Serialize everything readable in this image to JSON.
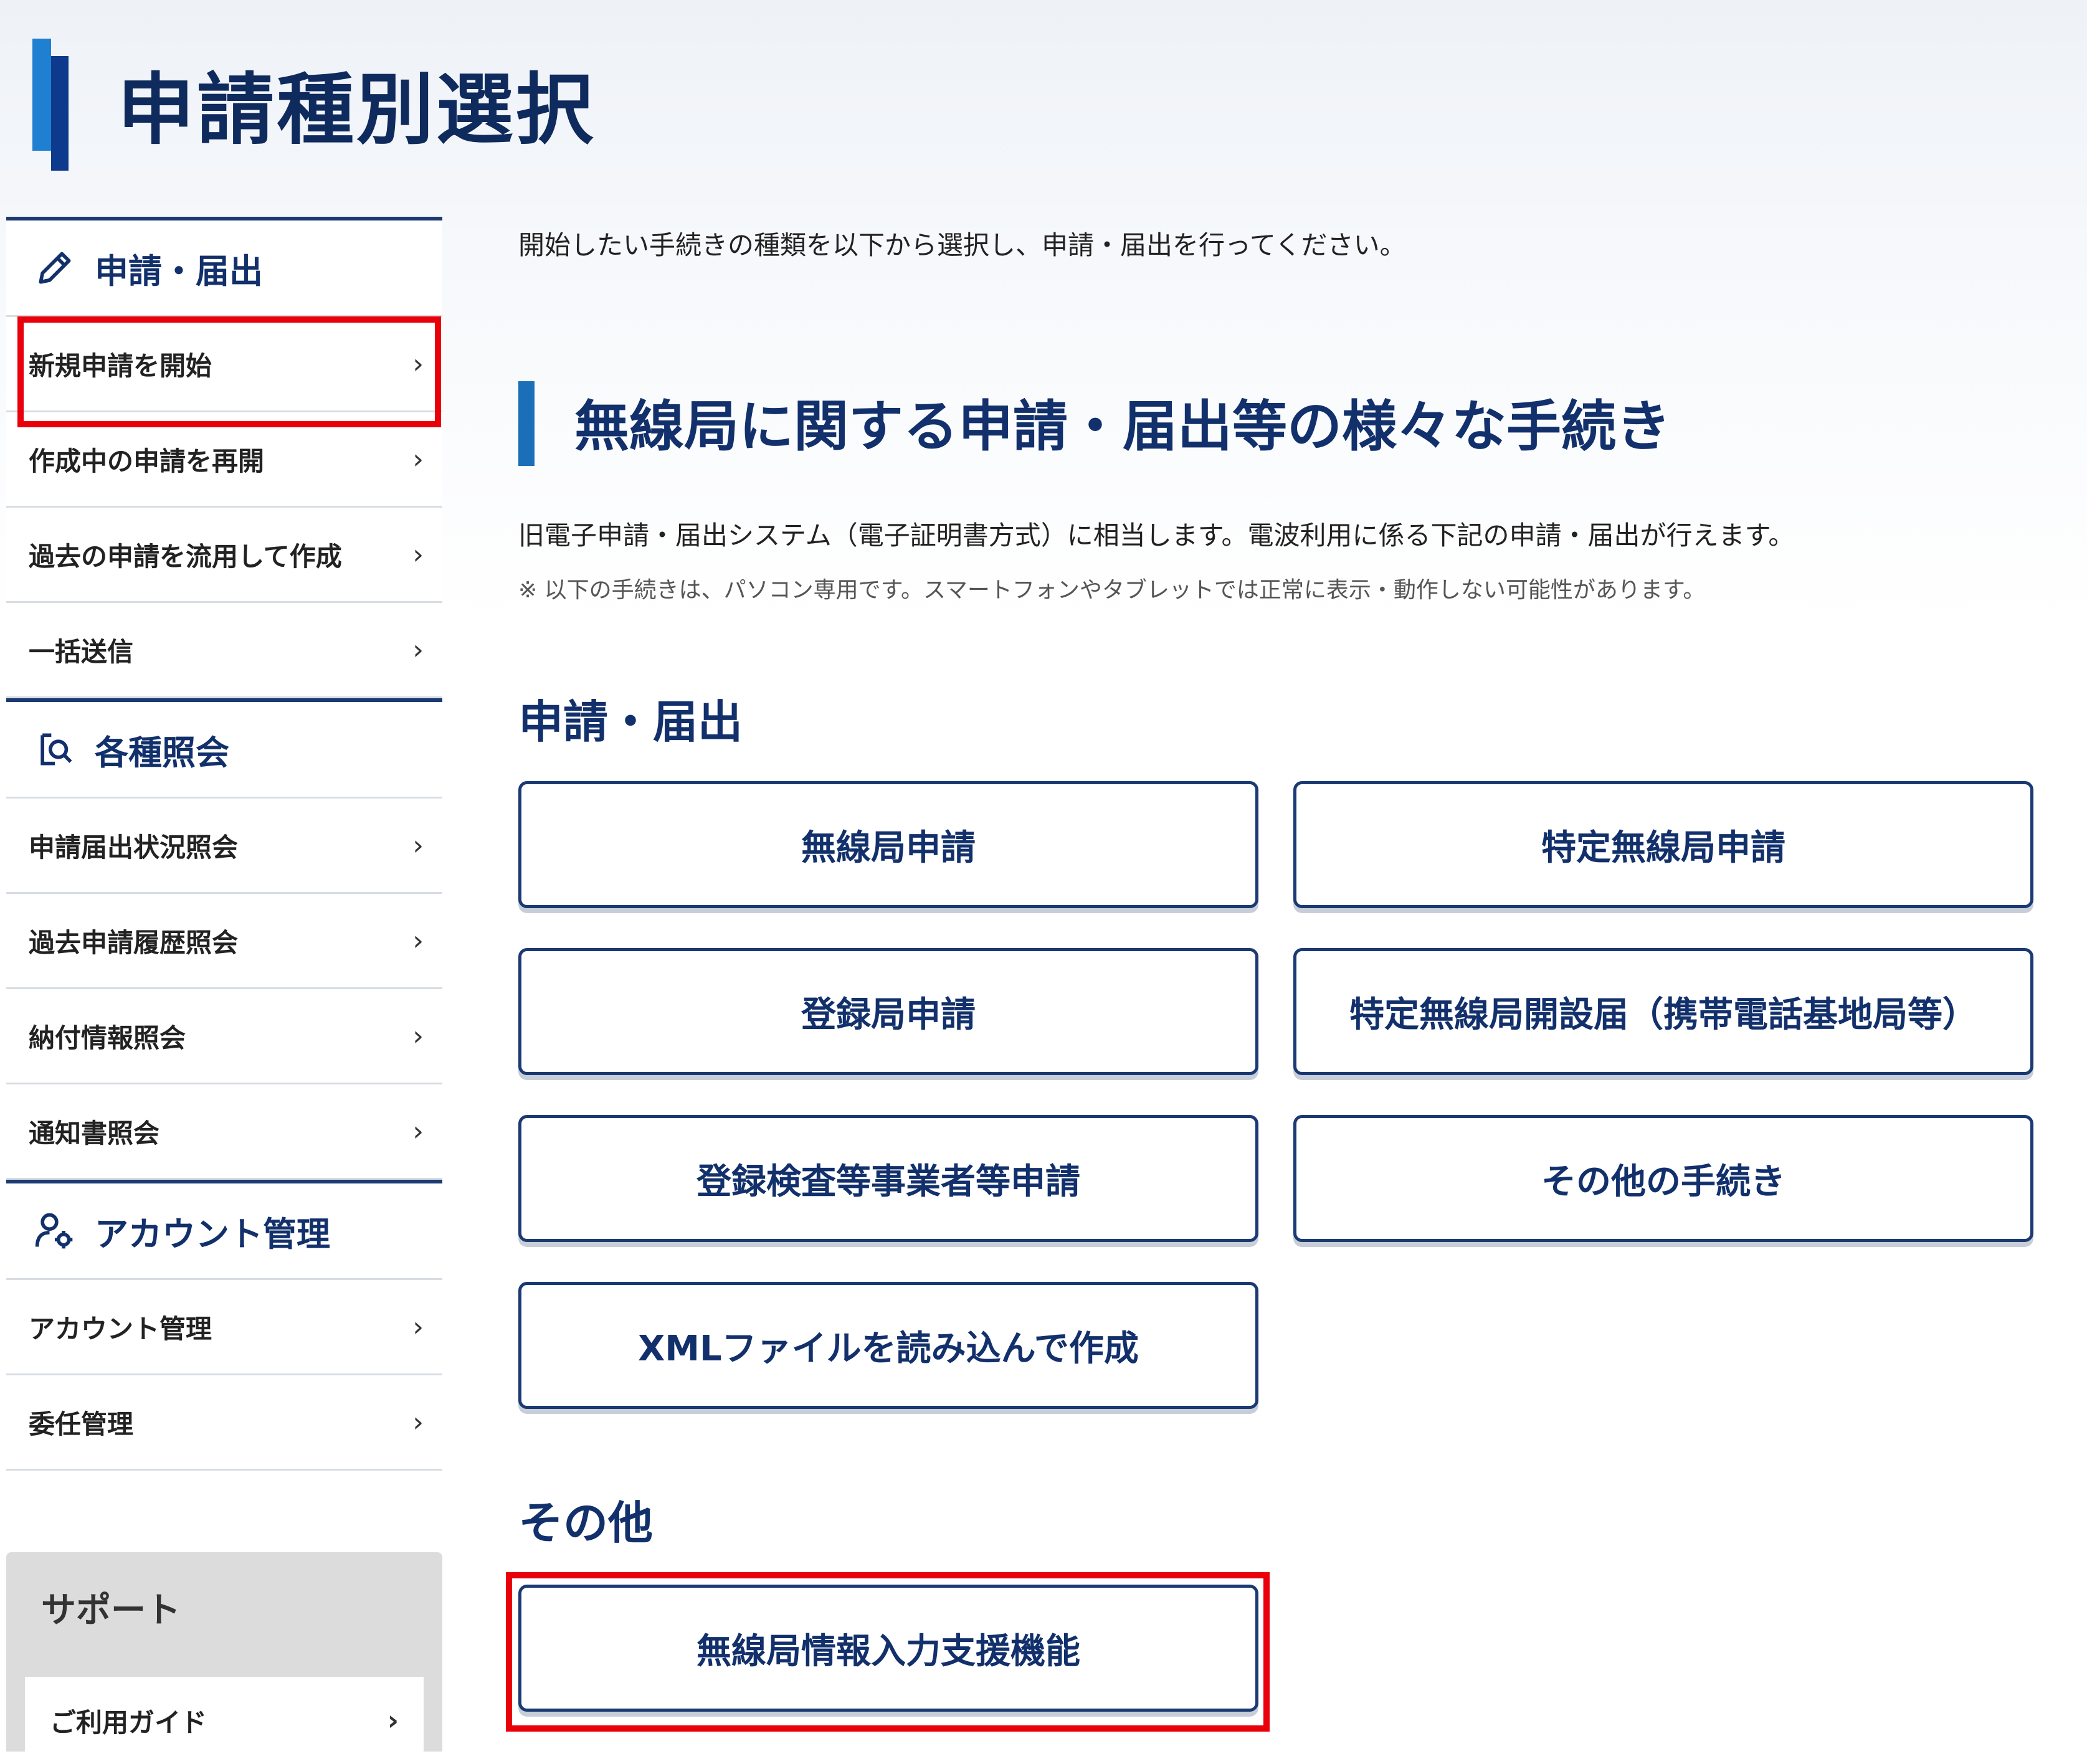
{
  "page": {
    "title": "申請種別選択"
  },
  "sidebar": {
    "sections": [
      {
        "heading": "申請・届出",
        "icon": "pencil-icon",
        "items": [
          {
            "label": "新規申請を開始",
            "highlighted": true
          },
          {
            "label": "作成中の申請を再開"
          },
          {
            "label": "過去の申請を流用して作成"
          },
          {
            "label": "一括送信"
          }
        ]
      },
      {
        "heading": "各種照会",
        "icon": "document-search-icon",
        "items": [
          {
            "label": "申請届出状況照会"
          },
          {
            "label": "過去申請履歴照会"
          },
          {
            "label": "納付情報照会"
          },
          {
            "label": "通知書照会"
          }
        ]
      },
      {
        "heading": "アカウント管理",
        "icon": "user-gear-icon",
        "items": [
          {
            "label": "アカウント管理"
          },
          {
            "label": "委任管理"
          }
        ]
      }
    ],
    "support": {
      "heading": "サポート",
      "items": [
        {
          "label": "ご利用ガイド"
        }
      ]
    },
    "chevron": "›"
  },
  "main": {
    "intro": "開始したい手続きの種類を以下から選択し、申請・届出を行ってください。",
    "section_title": "無線局に関する申請・届出等の様々な手続き",
    "description": "旧電子申請・届出システム（電子証明書方式）に相当します。電波利用に係る下記の申請・届出が行えます。",
    "note": "※ 以下の手続きは、パソコン専用です。スマートフォンやタブレットでは正常に表示・動作しない可能性があります。",
    "apply_heading": "申請・届出",
    "apply_buttons": [
      "無線局申請",
      "特定無線局申請",
      "登録局申請",
      "特定無線局開設届（携帯電話基地局等）",
      "登録検査等事業者等申請",
      "その他の手続き",
      "XMLファイルを読み込んで作成"
    ],
    "other_heading": "その他",
    "other_buttons": [
      {
        "label": "無線局情報入力支援機能",
        "highlighted": true
      }
    ]
  },
  "colors": {
    "accent": "#12306b",
    "highlight": "#e8000b",
    "title_bar_light": "#1f7fd0",
    "title_bar_dark": "#0d3a8c"
  }
}
